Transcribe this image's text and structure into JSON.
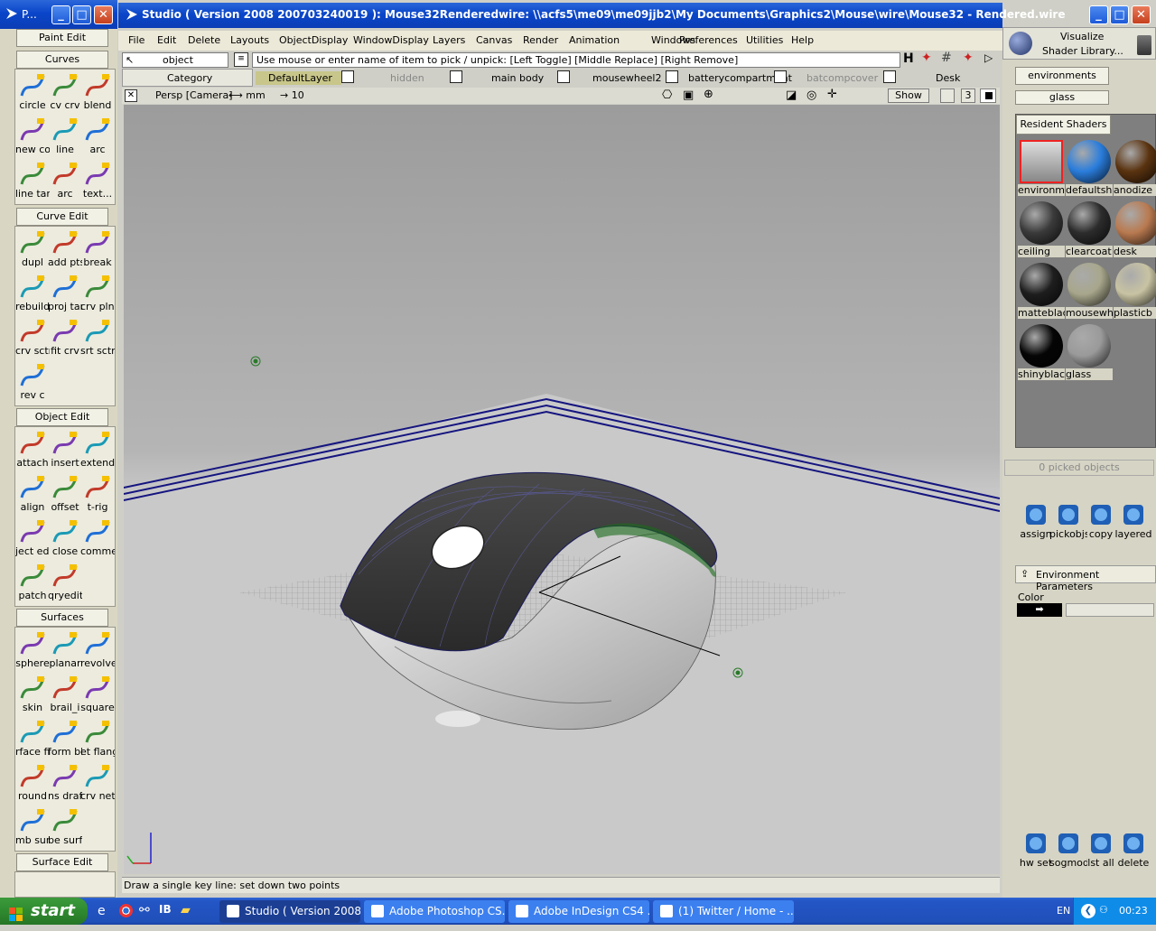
{
  "palette": {
    "title": "P...",
    "paint_edit": "Paint Edit",
    "sections": [
      {
        "header": "Curves",
        "tools": [
          {
            "label": "circle",
            "icon": "circle-icon"
          },
          {
            "label": "cv crv",
            "icon": "cv-curve-icon"
          },
          {
            "label": "blend",
            "icon": "blend-icon"
          },
          {
            "label": "new cos",
            "icon": "new-cos-icon"
          },
          {
            "label": "line",
            "icon": "line-icon"
          },
          {
            "label": "arc",
            "icon": "arc-icon"
          },
          {
            "label": "line tan",
            "icon": "line-tan-icon"
          },
          {
            "label": "arc",
            "icon": "arc-tan-icon"
          },
          {
            "label": "text...",
            "icon": "text-icon"
          }
        ]
      },
      {
        "header": "Curve Edit",
        "tools": [
          {
            "label": "dupl",
            "icon": "duplicate-icon"
          },
          {
            "label": "add pts",
            "icon": "add-points-icon"
          },
          {
            "label": "break",
            "icon": "break-icon"
          },
          {
            "label": "rebuild",
            "icon": "rebuild-icon"
          },
          {
            "label": "proj tan",
            "icon": "project-tangent-icon"
          },
          {
            "label": "crv plnr",
            "icon": "curve-planar-icon"
          },
          {
            "label": "crv sctn",
            "icon": "curve-section-icon"
          },
          {
            "label": "fit crv",
            "icon": "fit-curve-icon"
          },
          {
            "label": "srt sctns",
            "icon": "sort-sections-icon"
          },
          {
            "label": "rev c",
            "icon": "reverse-curve-icon"
          }
        ]
      },
      {
        "header": "Object Edit",
        "tools": [
          {
            "label": "attach",
            "icon": "attach-icon"
          },
          {
            "label": "insert",
            "icon": "insert-icon"
          },
          {
            "label": "extend",
            "icon": "extend-icon"
          },
          {
            "label": "align",
            "icon": "align-icon"
          },
          {
            "label": "offset",
            "icon": "offset-icon"
          },
          {
            "label": "t-rig",
            "icon": "t-rig-icon"
          },
          {
            "label": "ject edit",
            "icon": "object-edit-icon"
          },
          {
            "label": "close",
            "icon": "close-surface-icon"
          },
          {
            "label": "commen",
            "icon": "common-icon"
          },
          {
            "label": "patch",
            "icon": "patch-icon"
          },
          {
            "label": "qryedit",
            "icon": "query-edit-icon"
          }
        ]
      },
      {
        "header": "Surfaces",
        "tools": [
          {
            "label": "sphere",
            "icon": "sphere-icon"
          },
          {
            "label": "planar",
            "icon": "planar-icon"
          },
          {
            "label": "revolve",
            "icon": "revolve-icon"
          },
          {
            "label": "skin",
            "icon": "skin-icon"
          },
          {
            "label": "brail_i",
            "icon": "birail-icon"
          },
          {
            "label": "square",
            "icon": "square-icon"
          },
          {
            "label": "rface fill",
            "icon": "surface-fill-icon"
          },
          {
            "label": "form bll",
            "icon": "fillet-icon"
          },
          {
            "label": "et flang",
            "icon": "flange-icon"
          },
          {
            "label": "round",
            "icon": "round-icon"
          },
          {
            "label": "ns draft",
            "icon": "draft-icon"
          },
          {
            "label": "crv net",
            "icon": "curve-network-icon"
          },
          {
            "label": "mb surf",
            "icon": "multi-blend-icon"
          },
          {
            "label": "be surfa",
            "icon": "tube-surface-icon"
          }
        ]
      },
      {
        "header": "Surface Edit",
        "tools": []
      }
    ]
  },
  "main": {
    "title": "Studio ( Version 2008  200703240019 ): Mouse32Renderedwire: \\\\acfs5\\me09\\me09jjb2\\My Documents\\Graphics2\\Mouse\\wire\\Mouse32 - Rendered.wire",
    "menu": [
      "File",
      "Edit",
      "Delete",
      "Layouts",
      "ObjectDisplay",
      "WindowDisplay",
      "Layers",
      "Canvas",
      "Render",
      "Animation",
      "Windows",
      "Preferences",
      "Utilities",
      "Help"
    ],
    "pick_mode": "object",
    "prompt": "Use mouse or enter name of item to pick / unpick: [Left Toggle] [Middle Replace] [Right Remove]",
    "category_label": "Category",
    "layers": [
      "DefaultLayer",
      "hidden",
      "main body",
      "mousewheel2",
      "batterycompartment",
      "batcompcover",
      "Desk"
    ],
    "view_label": "Persp [Camera]",
    "units_label": "⟷ mm",
    "grid_label": "→ 10",
    "show_label": "Show",
    "view_count": "3",
    "status": "Draw a single key line: set down two points"
  },
  "right": {
    "visualize": "Visualize",
    "shader_library": "Shader Library...",
    "environments": "environments",
    "glass_tab": "glass",
    "resident_shaders": "Resident Shaders",
    "shaders": [
      {
        "name": "environm",
        "color": "#d0d0d0"
      },
      {
        "name": "defaultsh",
        "color": "#2a7ddc"
      },
      {
        "name": "anodize",
        "color": "#5a3310"
      },
      {
        "name": "ceiling",
        "color": "#3a3a3a"
      },
      {
        "name": "clearcoat",
        "color": "#2c2c2c"
      },
      {
        "name": "desk",
        "color": "#b97a50"
      },
      {
        "name": "matteblack",
        "color": "#1e1e1e"
      },
      {
        "name": "mousewh",
        "color": "#a8a78c"
      },
      {
        "name": "plasticb",
        "color": "#c8c3a3"
      },
      {
        "name": "shinyblack",
        "color": "#050505"
      },
      {
        "name": "glass",
        "color": "#9a9a9a"
      }
    ],
    "picked": "0 picked objects",
    "actions": [
      "assign",
      "pickobjs",
      "copy",
      "layered"
    ],
    "env_params": "Environment Parameters",
    "color_label": "Color",
    "bottom_actions": [
      "hw set",
      "sogmode",
      "lst all",
      "delete"
    ]
  },
  "taskbar": {
    "start": "start",
    "tasks": [
      "Studio ( Version 2008...",
      "Adobe Photoshop CS...",
      "Adobe InDesign CS4 ...",
      "(1) Twitter / Home - ..."
    ],
    "lang": "EN",
    "time": "00:23"
  }
}
